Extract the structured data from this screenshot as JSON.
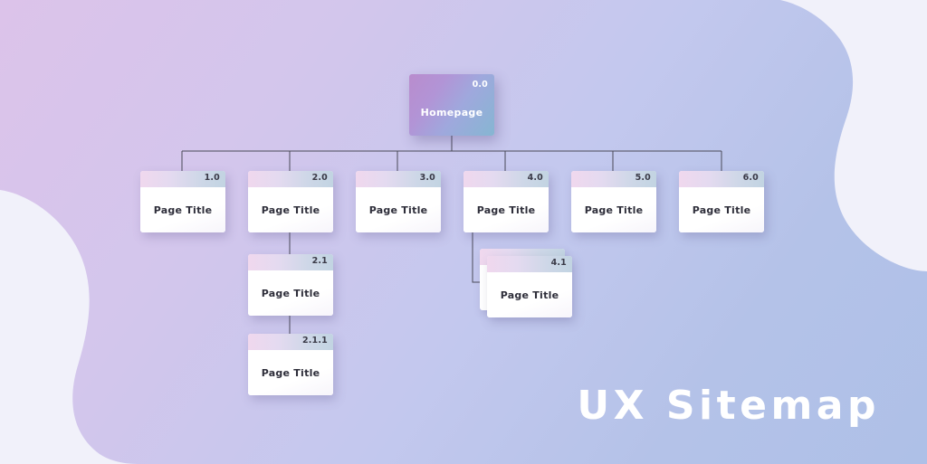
{
  "title": "UX Sitemap",
  "colors": {
    "bg_start": "#dcc3ea",
    "bg_end": "#aec0e7",
    "blob_light": "#f1f1fa",
    "blob_blue": "#adc0e8",
    "root_gradient_start": "#b98ccd",
    "root_gradient_end": "#86b6d2",
    "header_gradient_start": "#f0d8ee",
    "header_gradient_end": "#c2d4e2",
    "card_body": "#ffffff",
    "connector": "#4a4a58",
    "number_text": "#3a3a47",
    "title_text": "#ffffff"
  },
  "root": {
    "number": "0.0",
    "label": "Homepage",
    "name": "homepage-node"
  },
  "nodes": [
    {
      "number": "1.0",
      "label": "Page Title",
      "stacked": false
    },
    {
      "number": "2.0",
      "label": "Page Title",
      "stacked": false
    },
    {
      "number": "3.0",
      "label": "Page Title",
      "stacked": false
    },
    {
      "number": "4.0",
      "label": "Page Title",
      "stacked": false
    },
    {
      "number": "5.0",
      "label": "Page Title",
      "stacked": false
    },
    {
      "number": "6.0",
      "label": "Page Title",
      "stacked": false
    },
    {
      "number": "2.1",
      "label": "Page Title",
      "stacked": false
    },
    {
      "number": "2.1.1",
      "label": "Page Title",
      "stacked": false
    },
    {
      "number": "4.1",
      "label": "Page Title",
      "stacked": true
    }
  ]
}
